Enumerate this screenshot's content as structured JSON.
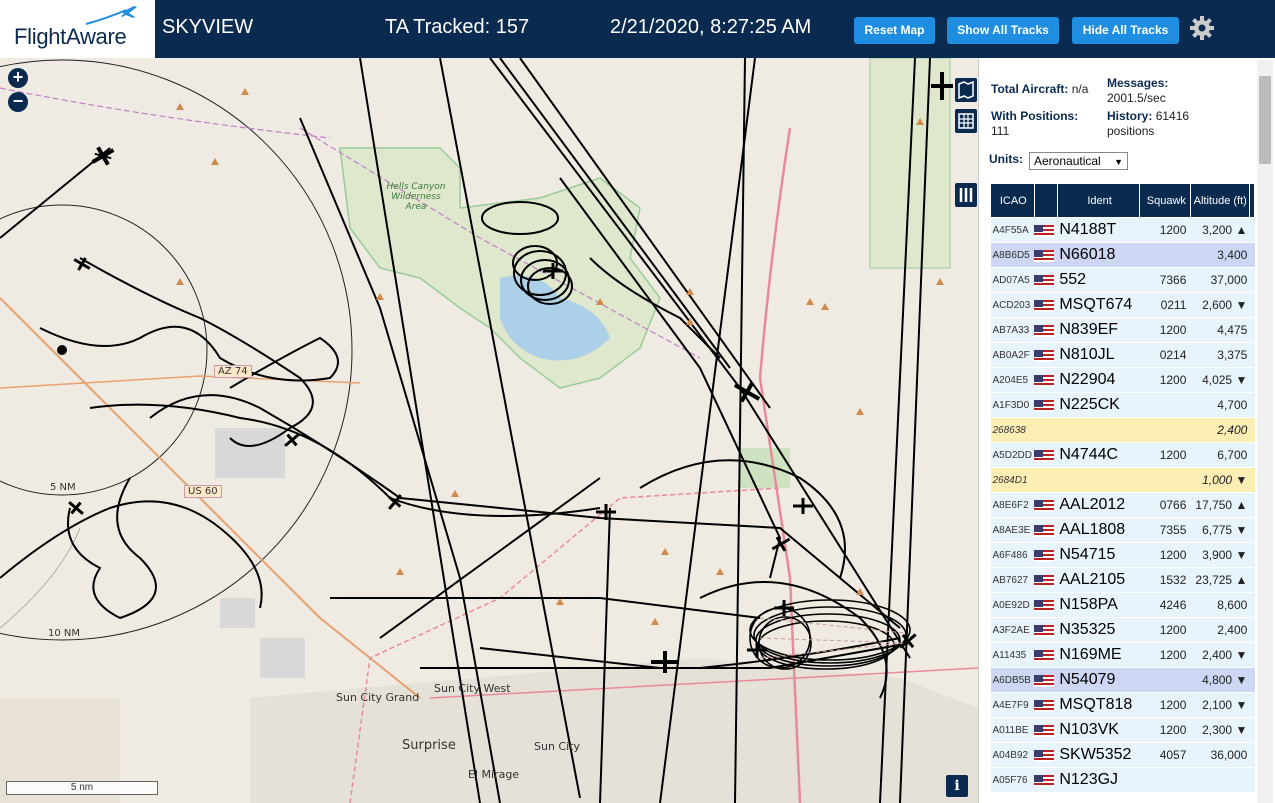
{
  "header": {
    "logo": "FlightAware",
    "title": "SKYVIEW",
    "tracked": "TA Tracked: 157",
    "clock": "2/21/2020, 8:27:25 AM",
    "buttons": {
      "reset": "Reset Map",
      "show_all": "Show All Tracks",
      "hide_all": "Hide All Tracks"
    }
  },
  "map": {
    "labels": {
      "wilderness": "Hells Canyon Wilderness Area",
      "sun_city_grand": "Sun City Grand",
      "sun_city_west": "Sun City West",
      "surprise": "Surprise",
      "sun_city": "Sun City",
      "el_mirage": "El Mirage",
      "ring_5": "5 NM",
      "ring_10": "10 NM",
      "az74": "AZ 74",
      "us60": "US 60"
    },
    "scale": "5 nm",
    "info": "i"
  },
  "panel": {
    "total_aircraft_label": "Total Aircraft:",
    "total_aircraft_value": "n/a",
    "messages_label": "Messages:",
    "messages_value": "2001.5/sec",
    "with_positions_label": "With Positions:",
    "with_positions_value": "111",
    "history_label": "History:",
    "history_value": "61416 positions",
    "units_label": "Units:",
    "units_value": "Aeronautical"
  },
  "table": {
    "headers": [
      "ICAO",
      "",
      "Ident",
      "Squawk",
      "Altitude (ft)"
    ],
    "rows": [
      {
        "icao": "A4F55A",
        "flag": true,
        "ident": "N4188T",
        "squawk": "1200",
        "alt": "3,200 ▲",
        "style": ""
      },
      {
        "icao": "A8B6D5",
        "flag": true,
        "ident": "N66018",
        "squawk": "",
        "alt": "3,400",
        "style": "sel"
      },
      {
        "icao": "AD07A5",
        "flag": true,
        "ident": "552",
        "squawk": "7366",
        "alt": "37,000",
        "style": ""
      },
      {
        "icao": "ACD203",
        "flag": true,
        "ident": "MSQT674",
        "squawk": "0211",
        "alt": "2,600 ▼",
        "style": ""
      },
      {
        "icao": "AB7A33",
        "flag": true,
        "ident": "N839EF",
        "squawk": "1200",
        "alt": "4,475",
        "style": ""
      },
      {
        "icao": "AB0A2F",
        "flag": true,
        "ident": "N810JL",
        "squawk": "0214",
        "alt": "3,375",
        "style": ""
      },
      {
        "icao": "A204E5",
        "flag": true,
        "ident": "N22904",
        "squawk": "1200",
        "alt": "4,025 ▼",
        "style": ""
      },
      {
        "icao": "A1F3D0",
        "flag": true,
        "ident": "N225CK",
        "squawk": "",
        "alt": "4,700",
        "style": ""
      },
      {
        "icao": "268638",
        "flag": false,
        "ident": "",
        "squawk": "",
        "alt": "2,400",
        "style": "yel"
      },
      {
        "icao": "A5D2DD",
        "flag": true,
        "ident": "N4744C",
        "squawk": "1200",
        "alt": "6,700",
        "style": ""
      },
      {
        "icao": "2684D1",
        "flag": false,
        "ident": "",
        "squawk": "",
        "alt": "1,000 ▼",
        "style": "yel"
      },
      {
        "icao": "A8E6F2",
        "flag": true,
        "ident": "AAL2012",
        "squawk": "0766",
        "alt": "17,750 ▲",
        "style": ""
      },
      {
        "icao": "A8AE3E",
        "flag": true,
        "ident": "AAL1808",
        "squawk": "7355",
        "alt": "6,775 ▼",
        "style": ""
      },
      {
        "icao": "A6F486",
        "flag": true,
        "ident": "N54715",
        "squawk": "1200",
        "alt": "3,900 ▼",
        "style": ""
      },
      {
        "icao": "AB7627",
        "flag": true,
        "ident": "AAL2105",
        "squawk": "1532",
        "alt": "23,725 ▲",
        "style": ""
      },
      {
        "icao": "A0E92D",
        "flag": true,
        "ident": "N158PA",
        "squawk": "4246",
        "alt": "8,600",
        "style": ""
      },
      {
        "icao": "A3F2AE",
        "flag": true,
        "ident": "N35325",
        "squawk": "1200",
        "alt": "2,400",
        "style": ""
      },
      {
        "icao": "A11435",
        "flag": true,
        "ident": "N169ME",
        "squawk": "1200",
        "alt": "2,400 ▼",
        "style": ""
      },
      {
        "icao": "A6DB5B",
        "flag": true,
        "ident": "N54079",
        "squawk": "",
        "alt": "4,800 ▼",
        "style": "sel"
      },
      {
        "icao": "A4E7F9",
        "flag": true,
        "ident": "MSQT818",
        "squawk": "1200",
        "alt": "2,100 ▼",
        "style": ""
      },
      {
        "icao": "A011BE",
        "flag": true,
        "ident": "N103VK",
        "squawk": "1200",
        "alt": "2,300 ▼",
        "style": ""
      },
      {
        "icao": "A04B92",
        "flag": true,
        "ident": "SKW5352",
        "squawk": "4057",
        "alt": "36,000",
        "style": ""
      },
      {
        "icao": "A05F76",
        "flag": true,
        "ident": "N123GJ",
        "squawk": "",
        "alt": "",
        "style": ""
      }
    ]
  }
}
